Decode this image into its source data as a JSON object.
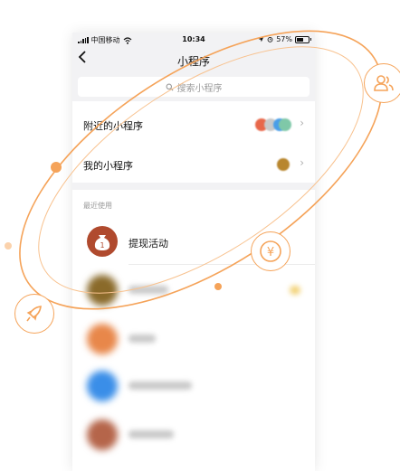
{
  "status_bar": {
    "carrier": "中国移动",
    "time": "10:34",
    "battery_percent": "57%",
    "battery_level": 0.57
  },
  "nav": {
    "back_icon": "chevron-left-icon",
    "title": "小程序"
  },
  "search": {
    "placeholder": "搜索小程序"
  },
  "menu": {
    "nearby_label": "附近的小程序",
    "mine_label": "我的小程序"
  },
  "recent": {
    "section_title": "最近使用",
    "items": [
      {
        "label": "提现活动",
        "icon": "money-bag-icon",
        "icon_text": "1"
      }
    ]
  },
  "decor": {
    "accent_color": "#f5a359",
    "icons": [
      "rocket-icon",
      "yuan-coin-icon",
      "users-icon"
    ],
    "yuan_symbol": "¥"
  }
}
